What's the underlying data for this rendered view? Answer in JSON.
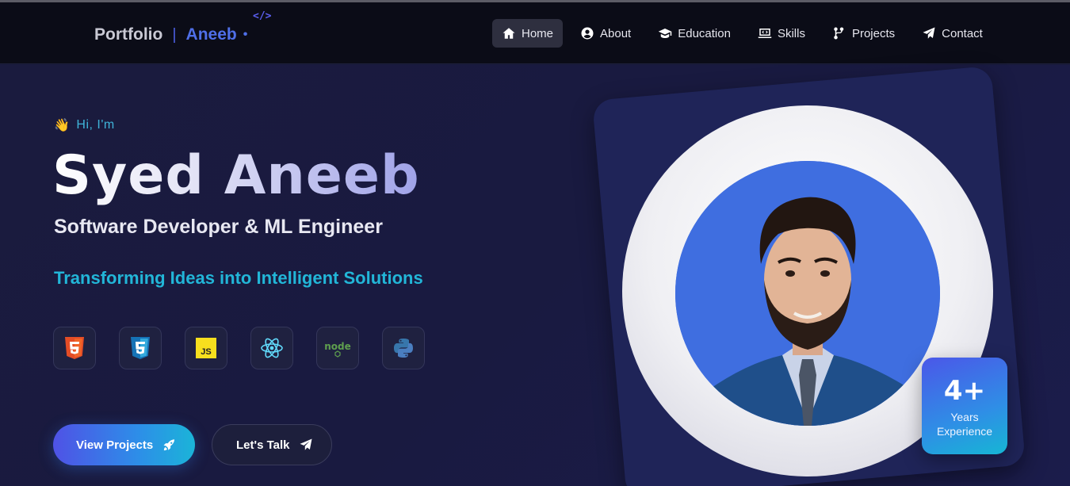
{
  "nav": {
    "brand_left": "Portfolio",
    "brand_sep": "|",
    "brand_right": "Aneeb",
    "brand_dot": "•",
    "brand_code": "</>",
    "links": [
      {
        "label": "Home",
        "icon": "home-icon",
        "active": true
      },
      {
        "label": "About",
        "icon": "user-circle-icon",
        "active": false
      },
      {
        "label": "Education",
        "icon": "graduation-cap-icon",
        "active": false
      },
      {
        "label": "Skills",
        "icon": "laptop-code-icon",
        "active": false
      },
      {
        "label": "Projects",
        "icon": "code-branch-icon",
        "active": false
      },
      {
        "label": "Contact",
        "icon": "paper-plane-icon",
        "active": false
      }
    ]
  },
  "hero": {
    "greeting_emoji": "👋",
    "greeting": "Hi, I'm",
    "name": "Syed Aneeb",
    "role": "Software Developer & ML Engineer",
    "tagline": "Transforming Ideas into Intelligent Solutions",
    "tech_icons": [
      "html5-icon",
      "css3-icon",
      "javascript-icon",
      "react-icon",
      "nodejs-icon",
      "python-icon"
    ],
    "primary_button": "View Projects",
    "secondary_button": "Let's Talk"
  },
  "experience": {
    "value": "4+",
    "label_line1": "Years",
    "label_line2": "Experience"
  },
  "colors": {
    "accent": "#4f6fe8",
    "cyan": "#22b6d8",
    "bg": "#161838",
    "nav_bg": "#0b0c17"
  }
}
